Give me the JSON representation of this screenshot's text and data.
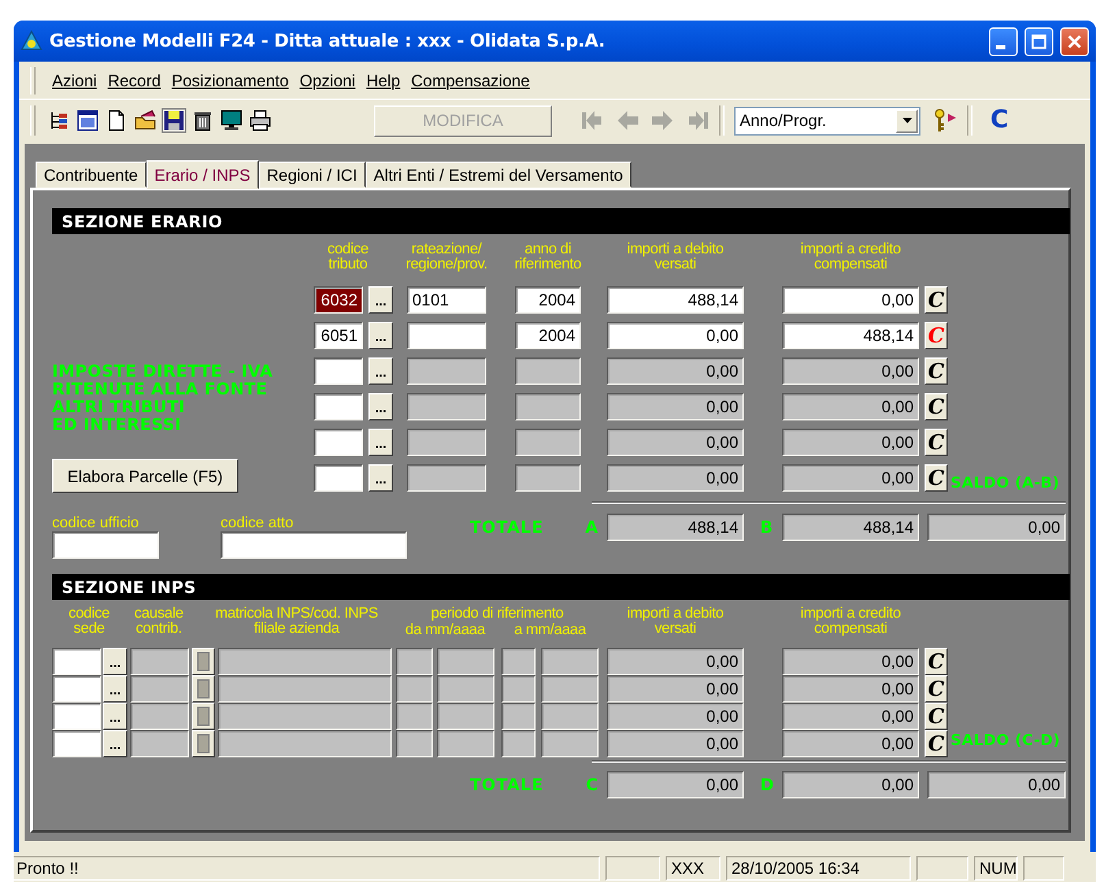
{
  "window": {
    "title": "Gestione Modelli F24 - Ditta attuale : xxx - Olidata S.p.A."
  },
  "menu": [
    "Azioni",
    "Record",
    "Posizionamento",
    "Opzioni",
    "Help",
    "Compensazione"
  ],
  "toolbar": {
    "modify_button": {
      "label": "MODIFICA",
      "disabled": true
    },
    "navigation_disabled": true,
    "sort_combo": {
      "value": "Anno/Progr."
    },
    "c_button": "C"
  },
  "tabs": [
    {
      "label": "Contribuente",
      "selected": false
    },
    {
      "label": "Erario / INPS",
      "selected": true
    },
    {
      "label": "Regioni / ICI",
      "selected": false
    },
    {
      "label": "Altri Enti / Estremi del Versamento",
      "selected": false
    }
  ],
  "erario": {
    "title": "SEZIONE ERARIO",
    "columns": [
      "codice\ntributo",
      "rateazione/\nregione/prov.",
      "anno di\nriferimento",
      "importi a debito\nversati",
      "importi a credito\ncompensati"
    ],
    "category_label": "IMPOSTE DIRETTE - IVA\nRITENUTE ALLA FONTE\nALTRI TRIBUTI\nED INTERESSI",
    "elabora_button": "Elabora Parcelle (F5)",
    "rows": [
      {
        "codice_tributo": "6032",
        "codice_selected": true,
        "lookup": "...",
        "rateazione": "0101",
        "anno": "2004",
        "debito": "488,14",
        "credito": "0,00",
        "enabled": true,
        "c_button": "C",
        "c_highlighted": false
      },
      {
        "codice_tributo": "6051",
        "codice_selected": false,
        "lookup": "...",
        "anno": "2004",
        "debito": "0,00",
        "credito": "488,14",
        "enabled": true,
        "c_button": "C",
        "c_highlighted": true
      },
      {
        "codice_selected": false,
        "lookup": "...",
        "debito": "0,00",
        "credito": "0,00",
        "enabled": false,
        "c_button": "C",
        "c_highlighted": false
      },
      {
        "codice_selected": false,
        "lookup": "...",
        "debito": "0,00",
        "credito": "0,00",
        "enabled": false,
        "c_button": "C",
        "c_highlighted": false
      },
      {
        "codice_selected": false,
        "lookup": "...",
        "debito": "0,00",
        "credito": "0,00",
        "enabled": false,
        "c_button": "C",
        "c_highlighted": false
      },
      {
        "codice_selected": false,
        "lookup": "...",
        "debito": "0,00",
        "credito": "0,00",
        "enabled": false,
        "c_button": "C",
        "c_highlighted": false
      }
    ],
    "saldo_label": "SALDO (A-B)",
    "codice_ufficio_label": "codice ufficio",
    "codice_atto_label": "codice atto",
    "totale_label": "TOTALE",
    "debit_total_label": "A",
    "debit_total": "488,14",
    "credit_total_label": "B",
    "credit_total": "488,14",
    "saldo": "0,00"
  },
  "inps": {
    "title": "SEZIONE INPS",
    "columns": {
      "codice_sede": "codice\nsede",
      "causale": "causale\ncontrib.",
      "matricola": "matricola INPS/cod. INPS\nfiliale azienda",
      "periodo": "periodo di riferimento",
      "da": "da mm/aaaa",
      "a": "a mm/aaaa",
      "debito": "importi a debito\nversati",
      "credito": "importi a credito\ncompensati"
    },
    "rows": [
      {
        "lookup": "...",
        "debito": "0,00",
        "credito": "0,00",
        "c_button": "C",
        "c_highlighted": false
      },
      {
        "lookup": "...",
        "debito": "0,00",
        "credito": "0,00",
        "c_button": "C",
        "c_highlighted": false
      },
      {
        "lookup": "...",
        "debito": "0,00",
        "credito": "0,00",
        "c_button": "C",
        "c_highlighted": false
      },
      {
        "lookup": "...",
        "debito": "0,00",
        "credito": "0,00",
        "c_button": "C",
        "c_highlighted": false
      }
    ],
    "saldo_label": "SALDO (C-D)",
    "totale_label": "TOTALE",
    "debit_total_label": "C",
    "debit_total": "0,00",
    "credit_total_label": "D",
    "credit_total": "0,00",
    "saldo": "0,00"
  },
  "status_bar": {
    "message": "Pronto !!",
    "user": "XXX",
    "datetime": "28/10/2005  16:34",
    "keyboard": "NUM"
  }
}
